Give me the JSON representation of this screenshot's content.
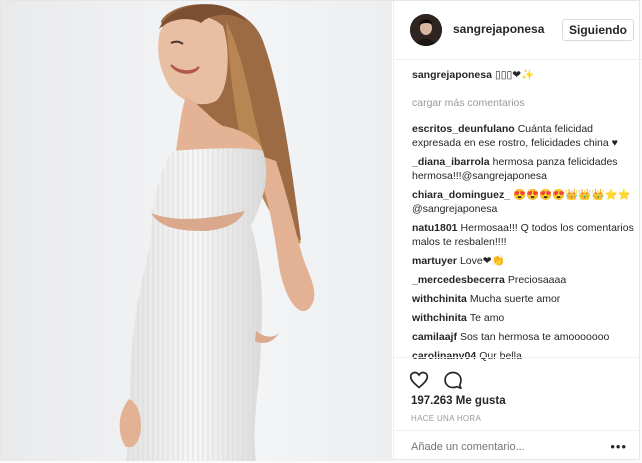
{
  "post": {
    "username": "sangrejaponesa",
    "follow_label": "Siguiendo",
    "caption_user": "sangrejaponesa",
    "caption_text": "▯▯▯❤✨",
    "load_more": "cargar más comentarios",
    "comments": [
      {
        "user": "escritos_deunfulano",
        "text": "Cuánta felicidad expresada en ese rostro, felicidades china ♥"
      },
      {
        "user": "_diana_ibarrola",
        "text": "hermosa panza felicidades hermosa!!!@sangrejaponesa"
      },
      {
        "user": "chiara_dominguez_",
        "text": "😍😍😍😍👑👑👑⭐⭐ @sangrejaponesa"
      },
      {
        "user": "natu1801",
        "text": "Hermosaa!!! Q todos los comentarios malos te resbalen!!!!"
      },
      {
        "user": "martuyer",
        "text": "Love❤👏"
      },
      {
        "user": "_mercedesbecerra",
        "text": "Preciosaaaa"
      },
      {
        "user": "withchinita",
        "text": "Mucha suerte amor"
      },
      {
        "user": "withchinita",
        "text": "Te amo"
      },
      {
        "user": "camilaajf",
        "text": "Sos tan hermosa te amooooooo"
      },
      {
        "user": "carolinanv04",
        "text": "Qur bella"
      }
    ],
    "likes": "197.263 Me gusta",
    "time": "HACE UNA HORA",
    "add_comment_placeholder": "Añade un comentario...",
    "more_icon": "more-dots-icon",
    "like_icon": "heart-icon",
    "comment_icon": "comment-icon"
  }
}
